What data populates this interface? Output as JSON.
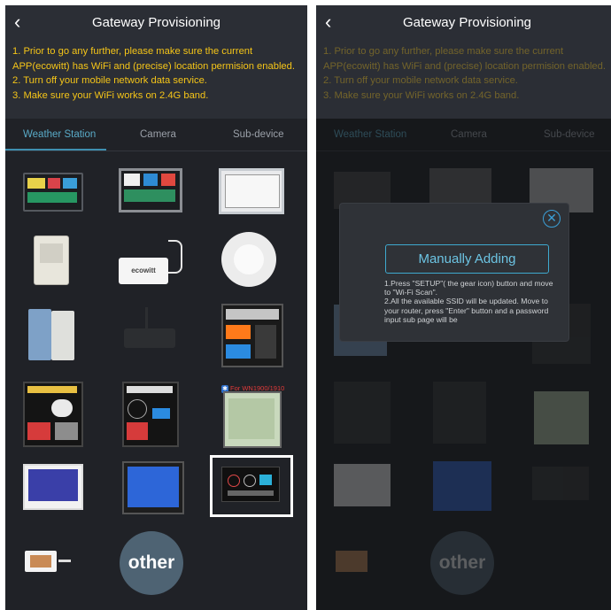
{
  "header": {
    "title": "Gateway Provisioning",
    "back_icon": "chevron-left-icon"
  },
  "instructions": [
    "1. Prior to go any further, please make sure the current",
    "APP(ecowitt) has WiFi and (precise) location permision enabled.",
    "2. Turn off your mobile network data service.",
    "3. Make sure your WiFi works on 2.4G band."
  ],
  "tabs": [
    {
      "label": "Weather Station",
      "active": true
    },
    {
      "label": "Camera",
      "active": false
    },
    {
      "label": "Sub-device",
      "active": false
    }
  ],
  "device_labels": {
    "ecowitt": "ecowitt",
    "bt_badge": "For WN1900/1910",
    "other": "other"
  },
  "dialog": {
    "close_icon": "close-circle-icon",
    "button_label": "Manually Adding",
    "text": [
      "1.Press \"SETUP\"( the gear icon) button and move to \"Wi-Fi Scan\".",
      "2.All the available SSID will be updated. Move to your router, press \"Enter\" button and a password input sub page will be"
    ]
  },
  "colors": {
    "accent": "#3f8fb0",
    "instruction_text": "#f5c518",
    "panel_bg": "#202227",
    "header_bg": "#2b2e35"
  }
}
